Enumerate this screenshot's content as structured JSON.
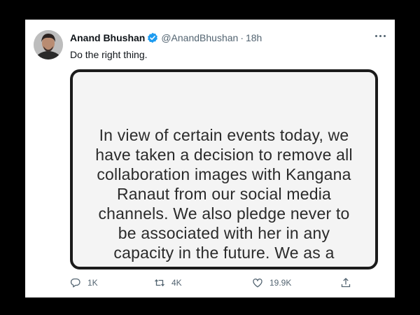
{
  "tweet": {
    "author_name": "Anand Bhushan",
    "handle": "@AnandBhushan",
    "separator": "·",
    "time": "18h",
    "text": "Do the right thing.",
    "image_text": "In view of certain events today, we\nhave taken a decision to remove all\ncollaboration images with Kangana\nRanaut from our social media\nchannels. We also pledge never to\nbe associated with her in any\ncapacity in the future. We as a"
  },
  "actions": {
    "reply_count": "1K",
    "retweet_count": "4K",
    "like_count": "19.9K"
  },
  "icons": {
    "verified": "verified-badge-icon",
    "more": "more-options-icon",
    "reply": "reply-icon",
    "retweet": "retweet-icon",
    "like": "like-heart-icon",
    "share": "share-icon"
  },
  "colors": {
    "background": "#000000",
    "card": "#ffffff",
    "verified_blue": "#1d9bf0",
    "muted": "#536471"
  }
}
